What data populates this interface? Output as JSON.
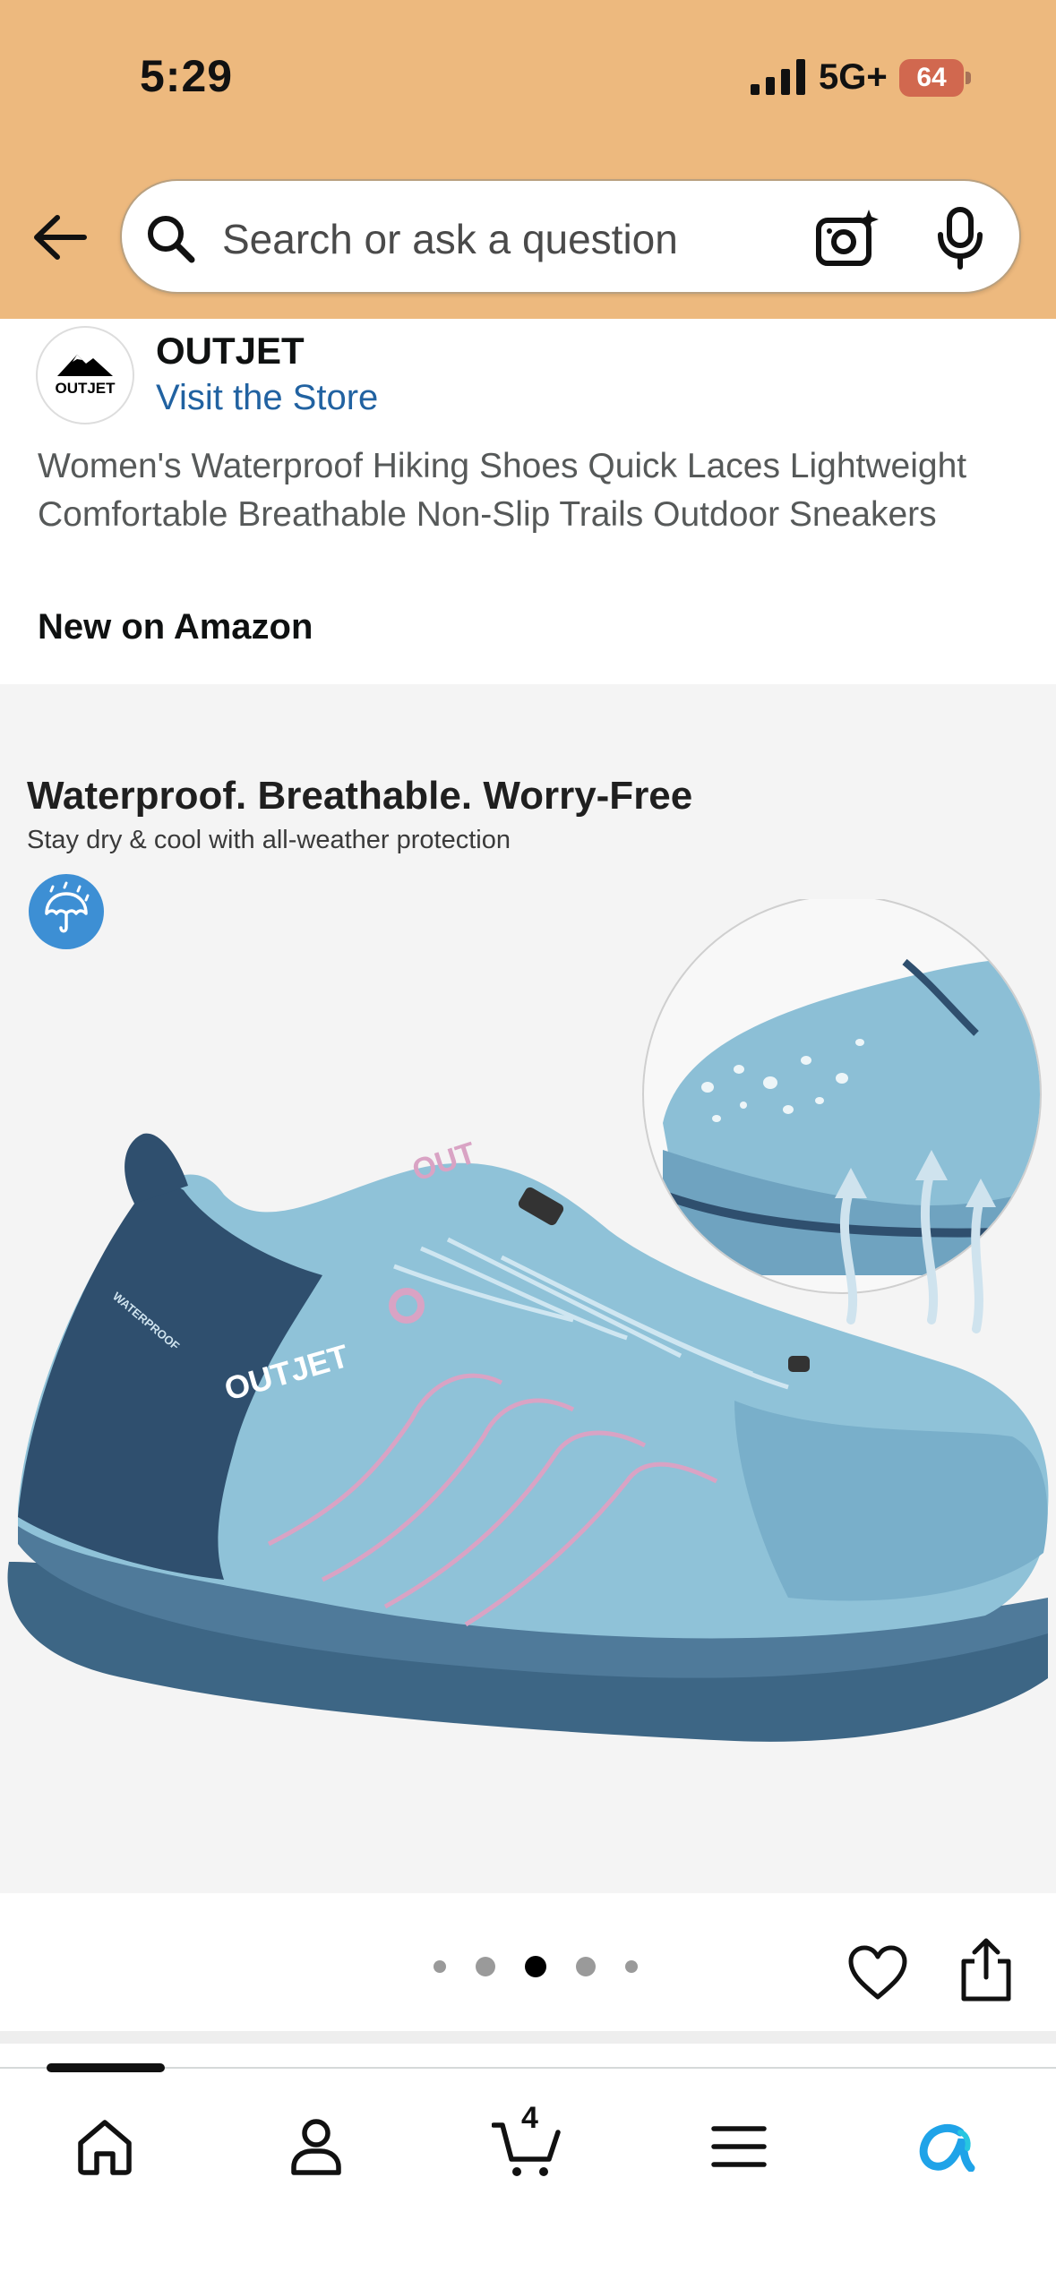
{
  "status_bar": {
    "time": "5:29",
    "network": "5G+",
    "battery": "64"
  },
  "search": {
    "placeholder": "Search or ask a question"
  },
  "store": {
    "logo_text": "OUTJET",
    "name": "OUTJET",
    "link_label": "Visit the Store"
  },
  "product": {
    "title": "Women's Waterproof Hiking Shoes Quick Laces Lightweight Comfortable Breathable Non-Slip Trails Outdoor Sneakers",
    "badge": "New on Amazon"
  },
  "image": {
    "heading": "Waterproof. Breathable. Worry-Free",
    "subheading": "Stay dry & cool with all-weather protection",
    "shoe_brand_text": "OUTJET",
    "shoe_side_text": "WATERPROOF"
  },
  "carousel": {
    "total_images": 5,
    "active_index": 2
  },
  "bottom_nav": {
    "items": [
      "home-icon",
      "account-icon",
      "cart-icon",
      "menu-icon",
      "rufus-icon"
    ],
    "cart_count": "4"
  },
  "colors": {
    "header_bg": "#edb97e",
    "link": "#2162a1",
    "shoe_light": "#8fc2d8",
    "shoe_dark": "#2f4f6e",
    "accent_pink": "#d9a3c4",
    "rufus_blue": "#1fa3e8"
  }
}
